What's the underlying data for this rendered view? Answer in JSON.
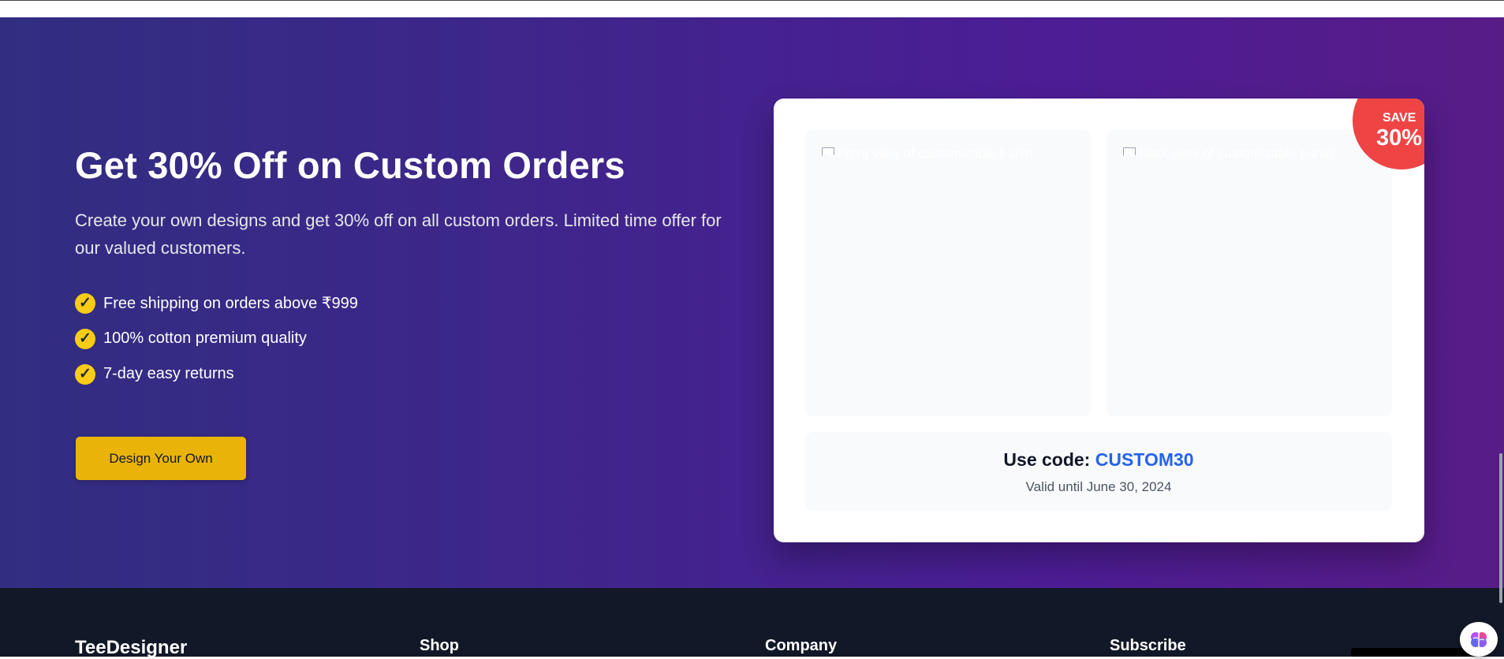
{
  "promo": {
    "title": "Get 30% Off on Custom Orders",
    "description": "Create your own designs and get 30% off on all custom orders. Limited time offer for our valued customers.",
    "benefits": [
      {
        "icon": "check-icon",
        "text": "Free shipping on orders above ₹999"
      },
      {
        "icon": "check-icon",
        "text": "100% cotton premium quality"
      },
      {
        "icon": "check-icon",
        "text": "7-day easy returns"
      }
    ],
    "cta_label": "Design Your Own",
    "colors": {
      "background_start": "#312e81",
      "background_end": "#581c87",
      "accent": "#eab308",
      "badge": "#ef4444",
      "code": "#2563eb"
    }
  },
  "offer_card": {
    "front_image_alt": "Front view of customizable t-shirt",
    "back_image_alt": "Back view of customizable t-shirt",
    "badge_label": "SAVE",
    "badge_value": "30%",
    "code_label": "Use code:",
    "code": "CUSTOM30",
    "valid_text": "Valid until June 30, 2024"
  },
  "footer": {
    "brand": "TeeDesigner",
    "headings": [
      "Shop",
      "Company",
      "Subscribe"
    ]
  },
  "widgets": {
    "assistant_icon": "brain-icon"
  }
}
